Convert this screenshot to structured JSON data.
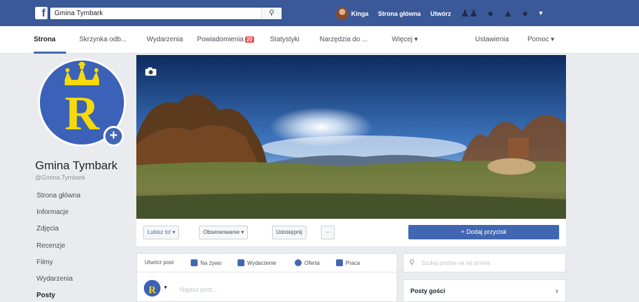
{
  "topbar": {
    "search_value": "Gmina Tymbark",
    "user_name": "Kinga",
    "home_label": "Strona główna",
    "create_label": "Utwórz",
    "icons": [
      "friends-icon",
      "messenger-icon",
      "notifications-icon",
      "help-icon",
      "account-menu-icon"
    ]
  },
  "pagenav": {
    "items": [
      "Strona",
      "Skrzynka odb...",
      "Wydarzenia",
      "Powiadomienia",
      "Statystyki",
      "Narzędzia do ...",
      "Więcej ▾",
      "Ustawienia",
      "Pomoc ▾"
    ],
    "notifications_badge": "20"
  },
  "page": {
    "name": "Gmina Tymbark",
    "handle": "@Gmina.Tymbark",
    "menu": [
      "Strona główna",
      "Informacje",
      "Zdjęcia",
      "Recenzje",
      "Filmy",
      "Wydarzenia",
      "Posty"
    ]
  },
  "actions": {
    "like": "Lubisz to! ▾",
    "follow": "Obserwowanie ▾",
    "share": "Udostępnij",
    "more": "···",
    "add_button": "+ Dodaj przycisk"
  },
  "composer": {
    "tabs": [
      "Utwórz post",
      "Na żywo",
      "Wydarzenie",
      "Oferta",
      "Praca"
    ],
    "placeholder": "Napisz post..."
  },
  "right": {
    "search_placeholder": "Szukaj postów na tej stronie",
    "guest_posts": "Posty gości"
  },
  "colors": {
    "brand_blue": "#3b5998",
    "button_blue": "#4267b2",
    "badge_red": "#fa3e3e",
    "emblem_gold": "#f5d90a"
  }
}
